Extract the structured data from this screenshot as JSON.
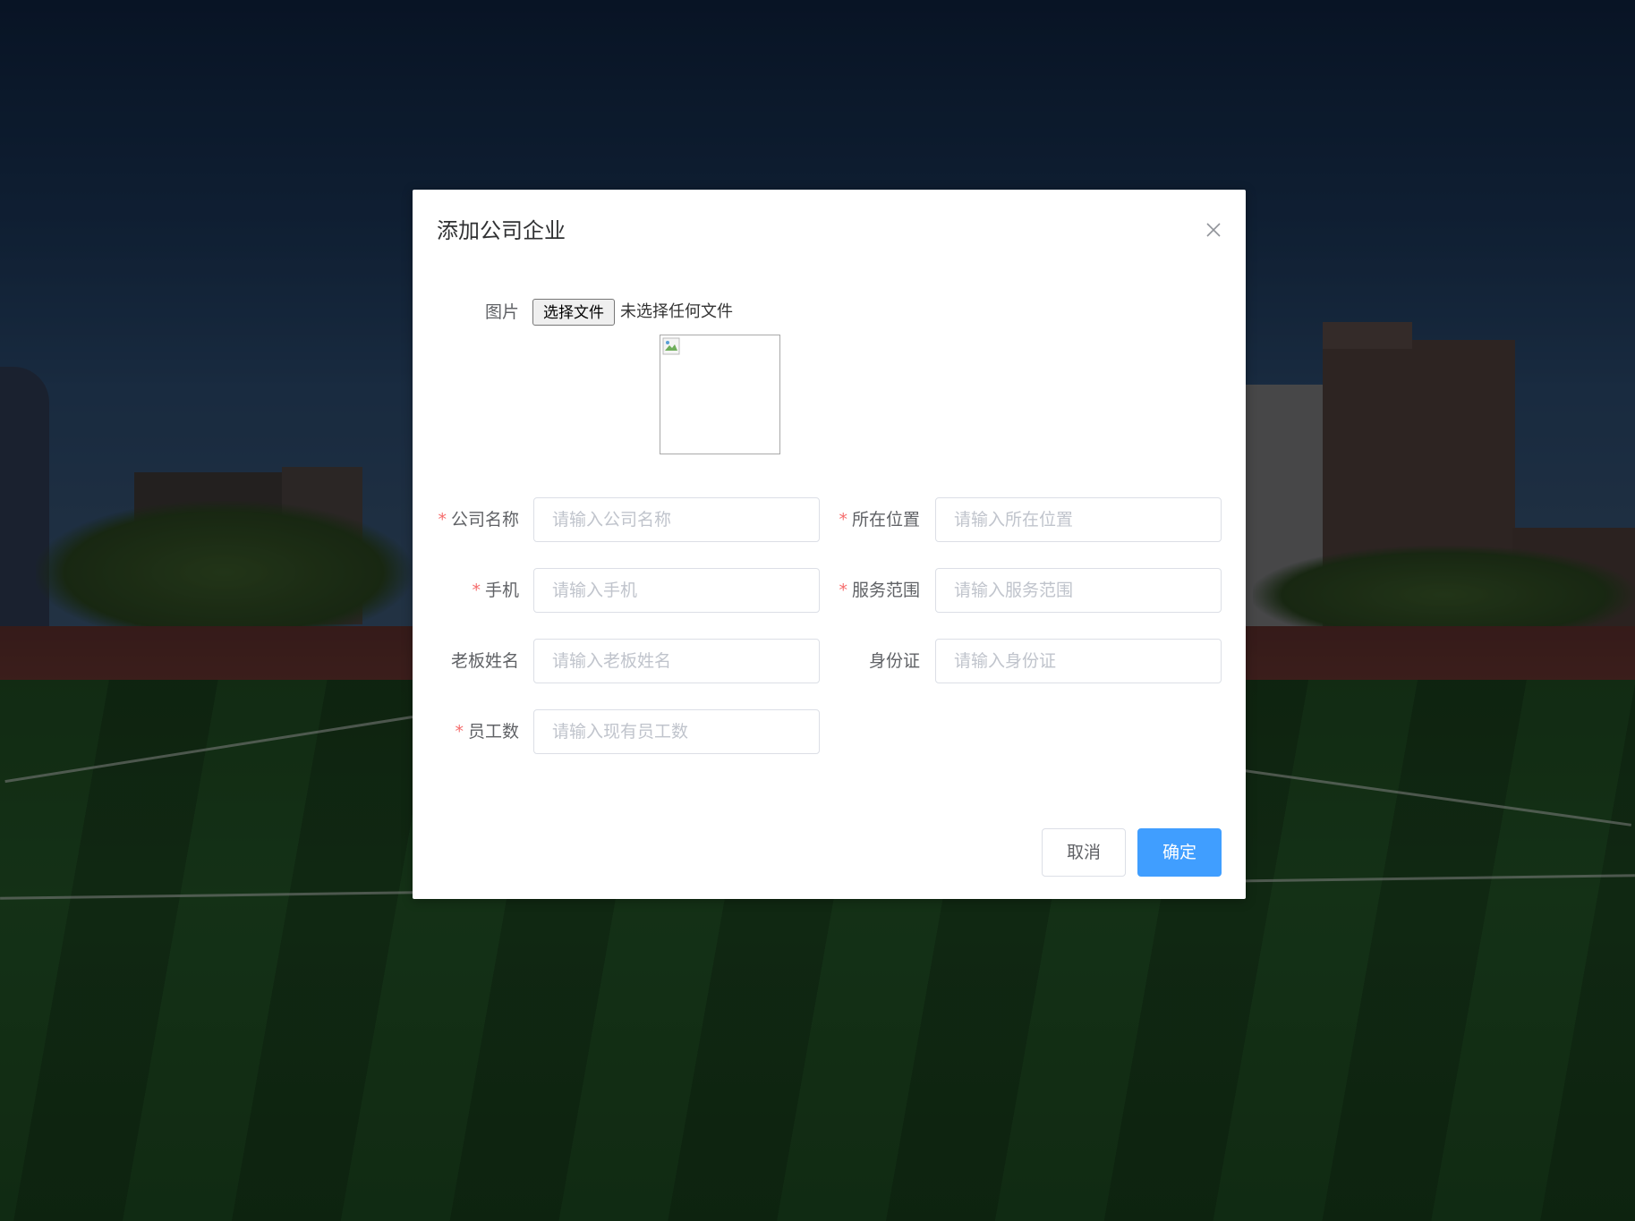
{
  "dialog": {
    "title": "添加公司企业",
    "close_icon": "close-icon"
  },
  "form": {
    "image": {
      "label": "图片",
      "choose_button": "选择文件",
      "status": "未选择任何文件"
    },
    "fields": [
      {
        "label": "公司名称",
        "placeholder": "请输入公司名称",
        "required": true
      },
      {
        "label": "所在位置",
        "placeholder": "请输入所在位置",
        "required": true
      },
      {
        "label": "手机",
        "placeholder": "请输入手机",
        "required": true
      },
      {
        "label": "服务范围",
        "placeholder": "请输入服务范围",
        "required": true
      },
      {
        "label": "老板姓名",
        "placeholder": "请输入老板姓名",
        "required": false
      },
      {
        "label": "身份证",
        "placeholder": "请输入身份证",
        "required": false
      },
      {
        "label": "员工数",
        "placeholder": "请输入现有员工数",
        "required": true
      }
    ],
    "required_mark": "*"
  },
  "footer": {
    "cancel_label": "取消",
    "confirm_label": "确定"
  },
  "colors": {
    "primary": "#409eff",
    "required": "#f56c6c",
    "overlay": "rgba(0,0,0,0.42)"
  }
}
